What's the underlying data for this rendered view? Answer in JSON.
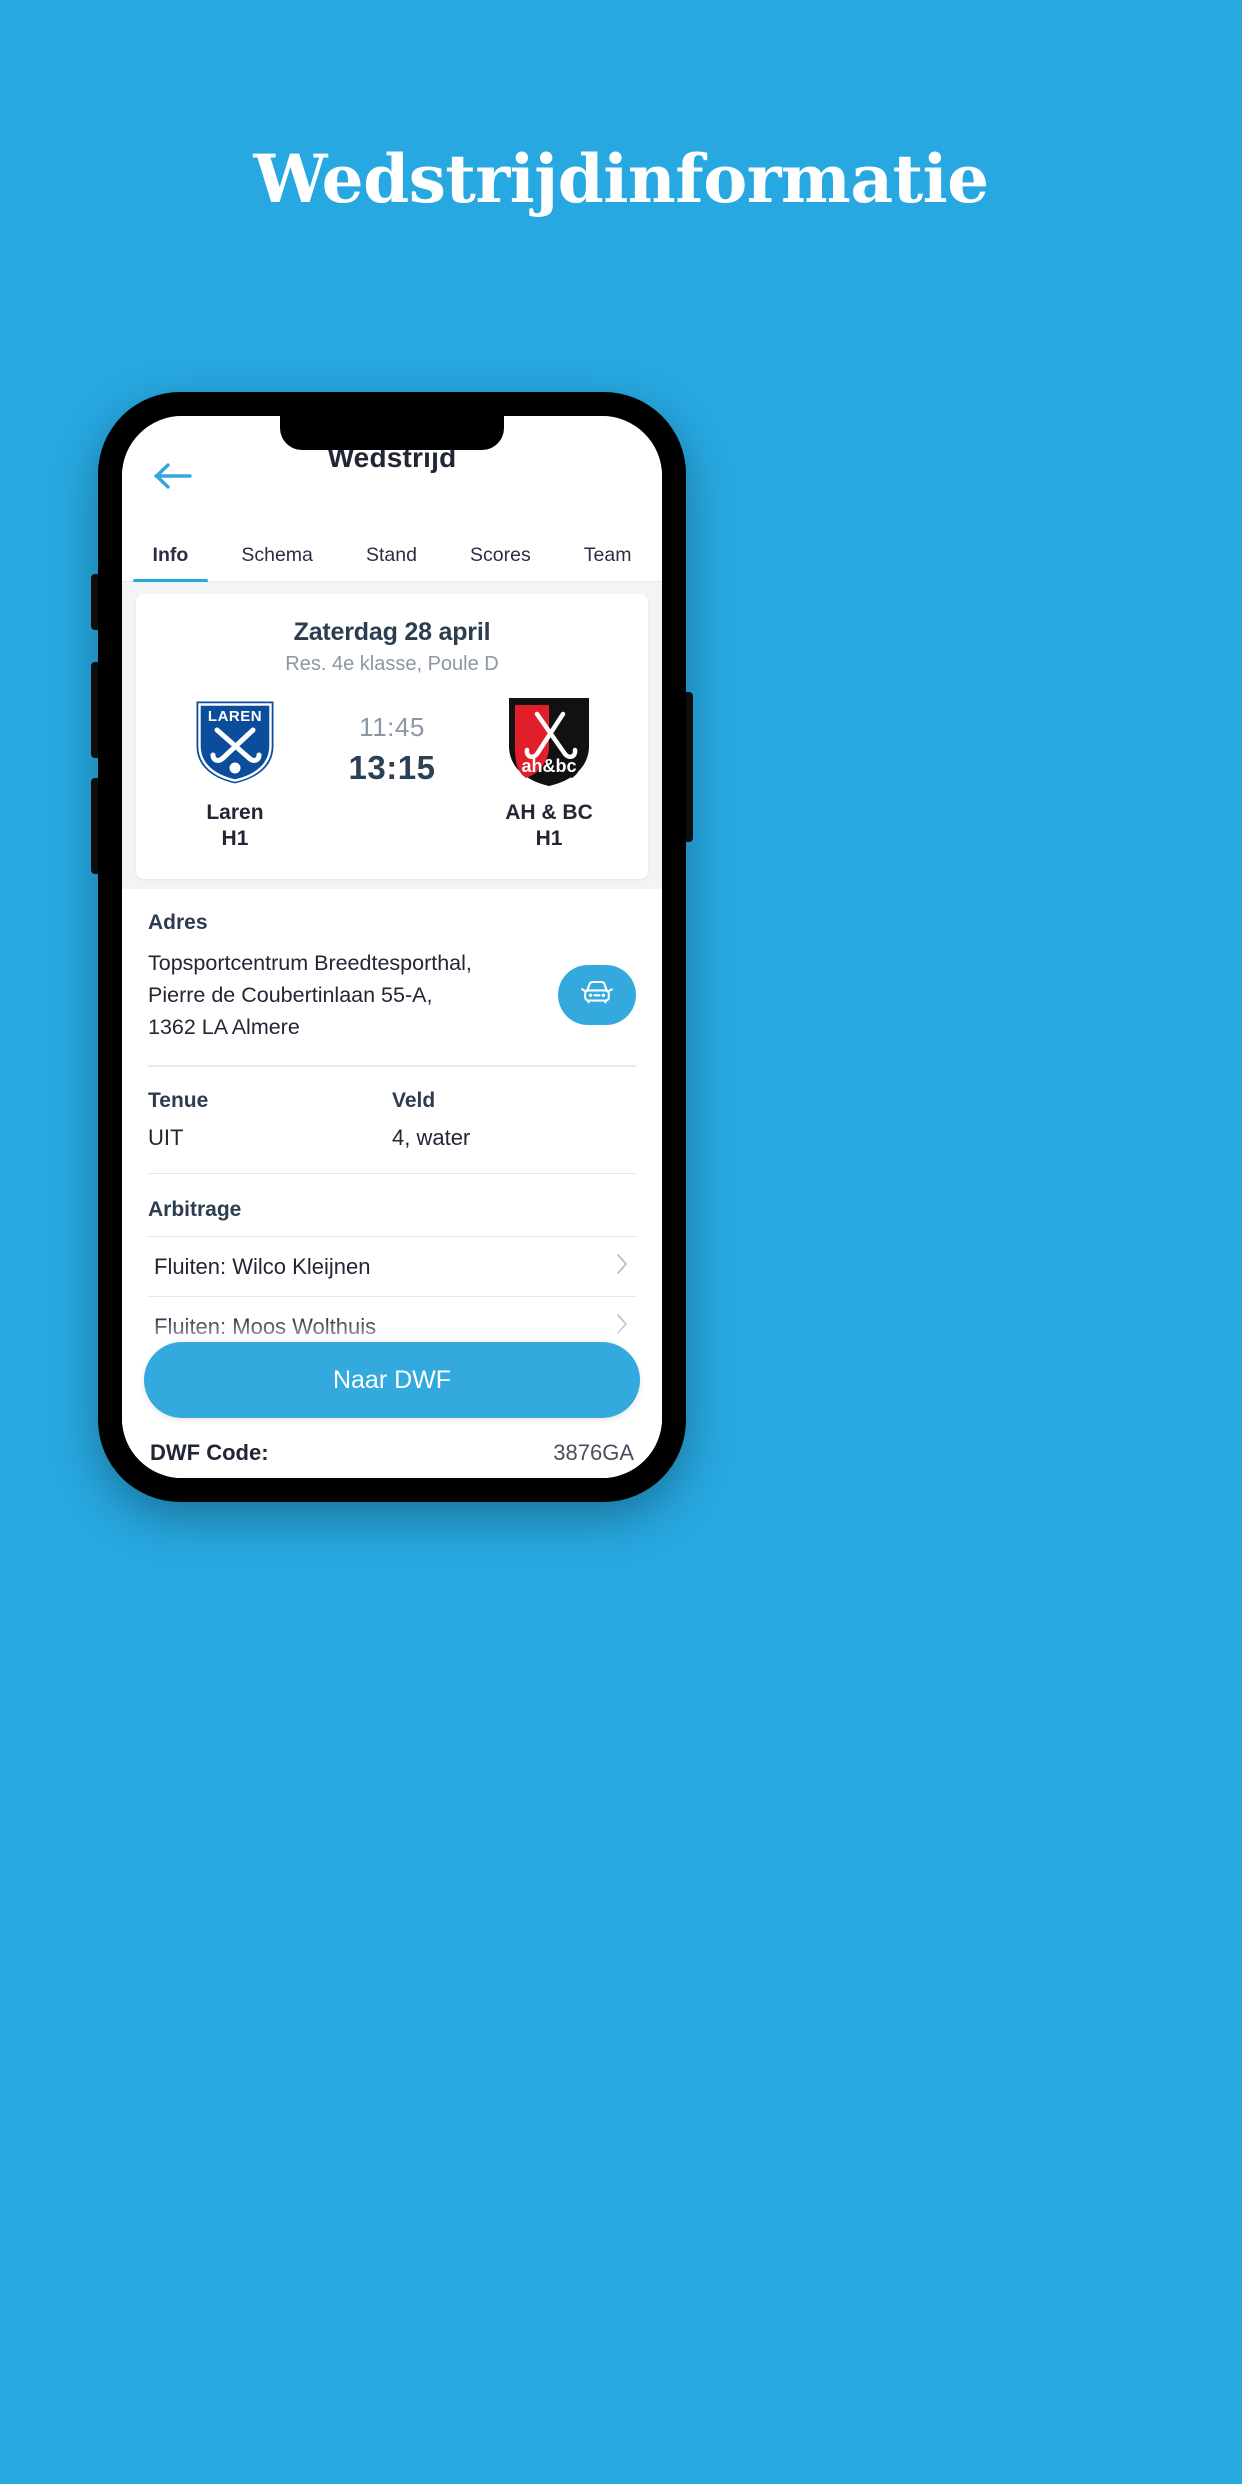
{
  "headline": "Wedstrijdinformatie",
  "app": {
    "title": "Wedstrijd",
    "back_icon": "arrow-left-icon"
  },
  "tabs": [
    {
      "label": "Info",
      "active": true
    },
    {
      "label": "Schema",
      "active": false
    },
    {
      "label": "Stand",
      "active": false
    },
    {
      "label": "Scores",
      "active": false
    },
    {
      "label": "Team",
      "active": false
    }
  ],
  "match": {
    "date": "Zaterdag 28 april",
    "competition": "Res. 4e klasse, Poule D",
    "time_planned": "11:45",
    "time_actual": "13:15",
    "home": {
      "name": "Laren\nH1",
      "logo_text": "LAREN",
      "logo_name": "laren-club-logo"
    },
    "away": {
      "name": "AH & BC\nH1",
      "logo_text": "ah&bc",
      "logo_name": "ahbc-club-logo"
    }
  },
  "details": {
    "address_label": "Adres",
    "address": "Topsportcentrum Breedtesporthal,\nPierre de Coubertinlaan 55-A,\n1362 LA Almere",
    "route_icon": "car-icon",
    "tenue_label": "Tenue",
    "tenue_value": "UIT",
    "veld_label": "Veld",
    "veld_value": "4, water",
    "arbitrage_label": "Arbitrage",
    "referees": [
      {
        "name": "Fluiten: Wilco Kleijnen",
        "chevron": "chevron-right-icon"
      },
      {
        "name": "Fluiten: Moos Wolthuis",
        "chevron": "chevron-right-icon"
      }
    ]
  },
  "cta": {
    "button_label": "Naar DWF",
    "dwf_code_label": "DWF Code:",
    "dwf_code_value": "3876GA"
  },
  "colors": {
    "background": "#27a8e0",
    "accent": "#33a9dd",
    "text_dark": "#232634",
    "text_muted": "#8b97a6"
  }
}
